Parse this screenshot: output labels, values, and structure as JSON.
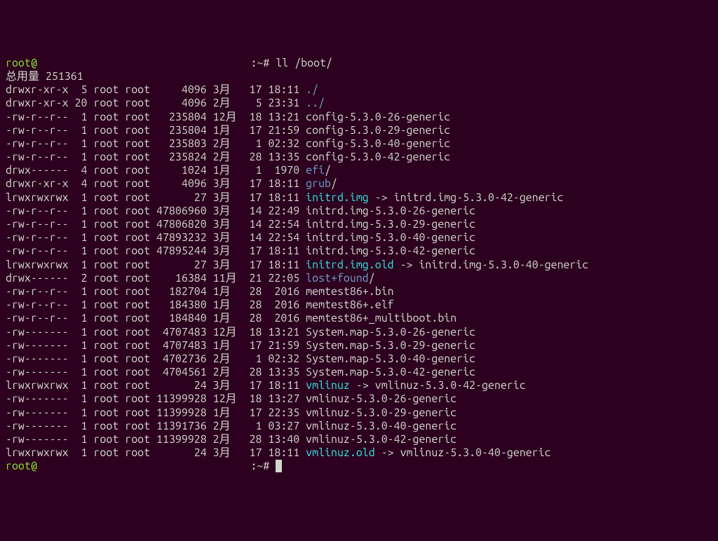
{
  "prompt1_user": "root",
  "prompt1_at": "@",
  "prompt1_host": "                                  ",
  "prompt1_path": ":~# ",
  "prompt1_cmd": "ll /boot/",
  "total_line": "总用量 251361",
  "files": [
    {
      "perms": "drwxr-xr-x",
      "links": " 5",
      "owner": "root",
      "group": "root",
      "size": "    4096",
      "month": "3月 ",
      "day": " 17",
      "time": "18:11",
      "name": "./",
      "color": "blue",
      "arrow": "",
      "target": "",
      "tcolor": "white"
    },
    {
      "perms": "drwxr-xr-x",
      "links": "20",
      "owner": "root",
      "group": "root",
      "size": "    4096",
      "month": "2月 ",
      "day": "  5",
      "time": "23:31",
      "name": "../",
      "color": "blue",
      "arrow": "",
      "target": "",
      "tcolor": "white"
    },
    {
      "perms": "-rw-r--r--",
      "links": " 1",
      "owner": "root",
      "group": "root",
      "size": "  235804",
      "month": "12月",
      "day": " 18",
      "time": "13:21",
      "name": "config-5.3.0-26-generic",
      "color": "white",
      "arrow": "",
      "target": "",
      "tcolor": "white"
    },
    {
      "perms": "-rw-r--r--",
      "links": " 1",
      "owner": "root",
      "group": "root",
      "size": "  235804",
      "month": "1月 ",
      "day": " 17",
      "time": "21:59",
      "name": "config-5.3.0-29-generic",
      "color": "white",
      "arrow": "",
      "target": "",
      "tcolor": "white"
    },
    {
      "perms": "-rw-r--r--",
      "links": " 1",
      "owner": "root",
      "group": "root",
      "size": "  235803",
      "month": "2月 ",
      "day": "  1",
      "time": "02:32",
      "name": "config-5.3.0-40-generic",
      "color": "white",
      "arrow": "",
      "target": "",
      "tcolor": "white"
    },
    {
      "perms": "-rw-r--r--",
      "links": " 1",
      "owner": "root",
      "group": "root",
      "size": "  235824",
      "month": "2月 ",
      "day": " 28",
      "time": "13:35",
      "name": "config-5.3.0-42-generic",
      "color": "white",
      "arrow": "",
      "target": "",
      "tcolor": "white"
    },
    {
      "perms": "drwx------",
      "links": " 4",
      "owner": "root",
      "group": "root",
      "size": "    1024",
      "month": "1月 ",
      "day": "  1",
      "time": " 1970",
      "name": "efi",
      "color": "blue",
      "arrow": "/",
      "target": "",
      "tcolor": "white"
    },
    {
      "perms": "drwxr-xr-x",
      "links": " 4",
      "owner": "root",
      "group": "root",
      "size": "    4096",
      "month": "3月 ",
      "day": " 17",
      "time": "18:11",
      "name": "grub",
      "color": "blue",
      "arrow": "/",
      "target": "",
      "tcolor": "white"
    },
    {
      "perms": "lrwxrwxrwx",
      "links": " 1",
      "owner": "root",
      "group": "root",
      "size": "      27",
      "month": "3月 ",
      "day": " 17",
      "time": "18:11",
      "name": "initrd.img",
      "color": "cyan",
      "arrow": " -> ",
      "target": "initrd.img-5.3.0-42-generic",
      "tcolor": "white"
    },
    {
      "perms": "-rw-r--r--",
      "links": " 1",
      "owner": "root",
      "group": "root",
      "size": "47806960",
      "month": "3月 ",
      "day": " 14",
      "time": "22:49",
      "name": "initrd.img-5.3.0-26-generic",
      "color": "white",
      "arrow": "",
      "target": "",
      "tcolor": "white"
    },
    {
      "perms": "-rw-r--r--",
      "links": " 1",
      "owner": "root",
      "group": "root",
      "size": "47806820",
      "month": "3月 ",
      "day": " 14",
      "time": "22:54",
      "name": "initrd.img-5.3.0-29-generic",
      "color": "white",
      "arrow": "",
      "target": "",
      "tcolor": "white"
    },
    {
      "perms": "-rw-r--r--",
      "links": " 1",
      "owner": "root",
      "group": "root",
      "size": "47893232",
      "month": "3月 ",
      "day": " 14",
      "time": "22:54",
      "name": "initrd.img-5.3.0-40-generic",
      "color": "white",
      "arrow": "",
      "target": "",
      "tcolor": "white"
    },
    {
      "perms": "-rw-r--r--",
      "links": " 1",
      "owner": "root",
      "group": "root",
      "size": "47895244",
      "month": "3月 ",
      "day": " 17",
      "time": "18:11",
      "name": "initrd.img-5.3.0-42-generic",
      "color": "white",
      "arrow": "",
      "target": "",
      "tcolor": "white"
    },
    {
      "perms": "lrwxrwxrwx",
      "links": " 1",
      "owner": "root",
      "group": "root",
      "size": "      27",
      "month": "3月 ",
      "day": " 17",
      "time": "18:11",
      "name": "initrd.img.old",
      "color": "cyan",
      "arrow": " -> ",
      "target": "initrd.img-5.3.0-40-generic",
      "tcolor": "white"
    },
    {
      "perms": "drwx------",
      "links": " 2",
      "owner": "root",
      "group": "root",
      "size": "   16384",
      "month": "11月",
      "day": " 21",
      "time": "22:05",
      "name": "lost+found",
      "color": "blue",
      "arrow": "/",
      "target": "",
      "tcolor": "white"
    },
    {
      "perms": "-rw-r--r--",
      "links": " 1",
      "owner": "root",
      "group": "root",
      "size": "  182704",
      "month": "1月 ",
      "day": " 28",
      "time": " 2016",
      "name": "memtest86+.bin",
      "color": "white",
      "arrow": "",
      "target": "",
      "tcolor": "white"
    },
    {
      "perms": "-rw-r--r--",
      "links": " 1",
      "owner": "root",
      "group": "root",
      "size": "  184380",
      "month": "1月 ",
      "day": " 28",
      "time": " 2016",
      "name": "memtest86+.elf",
      "color": "white",
      "arrow": "",
      "target": "",
      "tcolor": "white"
    },
    {
      "perms": "-rw-r--r--",
      "links": " 1",
      "owner": "root",
      "group": "root",
      "size": "  184840",
      "month": "1月 ",
      "day": " 28",
      "time": " 2016",
      "name": "memtest86+_multiboot.bin",
      "color": "white",
      "arrow": "",
      "target": "",
      "tcolor": "white"
    },
    {
      "perms": "-rw-------",
      "links": " 1",
      "owner": "root",
      "group": "root",
      "size": " 4707483",
      "month": "12月",
      "day": " 18",
      "time": "13:21",
      "name": "System.map-5.3.0-26-generic",
      "color": "white",
      "arrow": "",
      "target": "",
      "tcolor": "white"
    },
    {
      "perms": "-rw-------",
      "links": " 1",
      "owner": "root",
      "group": "root",
      "size": " 4707483",
      "month": "1月 ",
      "day": " 17",
      "time": "21:59",
      "name": "System.map-5.3.0-29-generic",
      "color": "white",
      "arrow": "",
      "target": "",
      "tcolor": "white"
    },
    {
      "perms": "-rw-------",
      "links": " 1",
      "owner": "root",
      "group": "root",
      "size": " 4702736",
      "month": "2月 ",
      "day": "  1",
      "time": "02:32",
      "name": "System.map-5.3.0-40-generic",
      "color": "white",
      "arrow": "",
      "target": "",
      "tcolor": "white"
    },
    {
      "perms": "-rw-------",
      "links": " 1",
      "owner": "root",
      "group": "root",
      "size": " 4704561",
      "month": "2月 ",
      "day": " 28",
      "time": "13:35",
      "name": "System.map-5.3.0-42-generic",
      "color": "white",
      "arrow": "",
      "target": "",
      "tcolor": "white"
    },
    {
      "perms": "lrwxrwxrwx",
      "links": " 1",
      "owner": "root",
      "group": "root",
      "size": "      24",
      "month": "3月 ",
      "day": " 17",
      "time": "18:11",
      "name": "vmlinuz",
      "color": "cyan",
      "arrow": " -> ",
      "target": "vmlinuz-5.3.0-42-generic",
      "tcolor": "white"
    },
    {
      "perms": "-rw-------",
      "links": " 1",
      "owner": "root",
      "group": "root",
      "size": "11399928",
      "month": "12月",
      "day": " 18",
      "time": "13:27",
      "name": "vmlinuz-5.3.0-26-generic",
      "color": "white",
      "arrow": "",
      "target": "",
      "tcolor": "white"
    },
    {
      "perms": "-rw-------",
      "links": " 1",
      "owner": "root",
      "group": "root",
      "size": "11399928",
      "month": "1月 ",
      "day": " 17",
      "time": "22:35",
      "name": "vmlinuz-5.3.0-29-generic",
      "color": "white",
      "arrow": "",
      "target": "",
      "tcolor": "white"
    },
    {
      "perms": "-rw-------",
      "links": " 1",
      "owner": "root",
      "group": "root",
      "size": "11391736",
      "month": "2月 ",
      "day": "  1",
      "time": "03:27",
      "name": "vmlinuz-5.3.0-40-generic",
      "color": "white",
      "arrow": "",
      "target": "",
      "tcolor": "white"
    },
    {
      "perms": "-rw-------",
      "links": " 1",
      "owner": "root",
      "group": "root",
      "size": "11399928",
      "month": "2月 ",
      "day": " 28",
      "time": "13:40",
      "name": "vmlinuz-5.3.0-42-generic",
      "color": "white",
      "arrow": "",
      "target": "",
      "tcolor": "white"
    },
    {
      "perms": "lrwxrwxrwx",
      "links": " 1",
      "owner": "root",
      "group": "root",
      "size": "      24",
      "month": "3月 ",
      "day": " 17",
      "time": "18:11",
      "name": "vmlinuz.old",
      "color": "cyan",
      "arrow": " -> ",
      "target": "vmlinuz-5.3.0-40-generic",
      "tcolor": "white"
    }
  ],
  "prompt2_user": "root",
  "prompt2_at": "@",
  "prompt2_host": "                                  ",
  "prompt2_path": ":~# "
}
